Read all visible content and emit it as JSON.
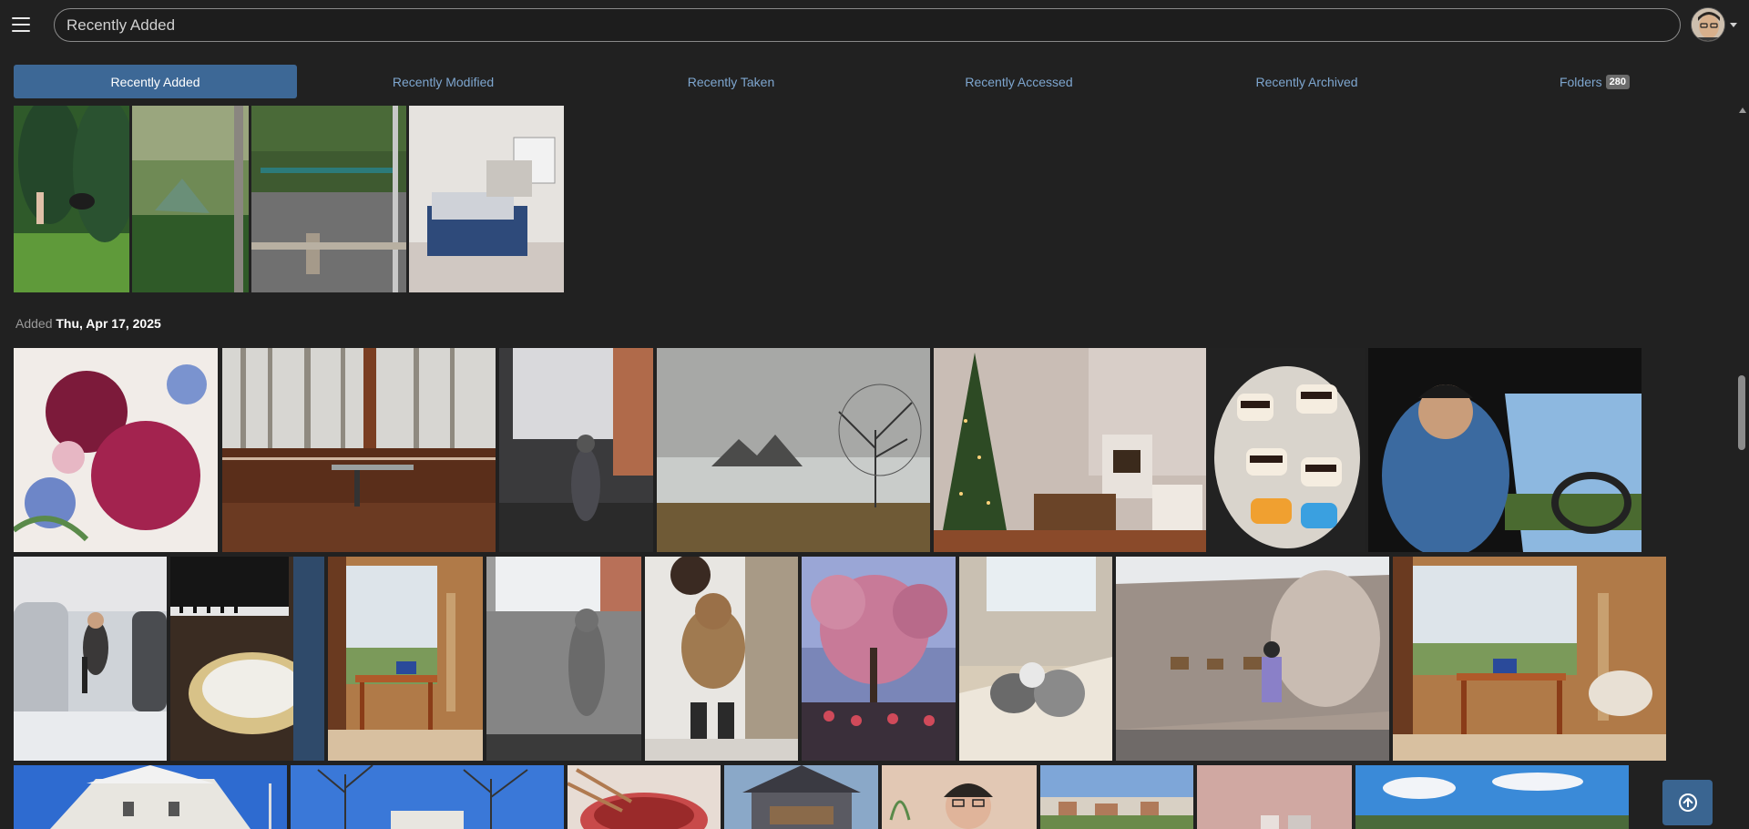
{
  "search": {
    "value": "Recently Added"
  },
  "icons": {
    "menu": "hamburger-icon",
    "avatar": "user-avatar",
    "caret": "chevron-down-icon",
    "back_to_top": "arrow-up-circle-icon"
  },
  "tabs": [
    {
      "label": "Recently Added",
      "active": true
    },
    {
      "label": "Recently Modified"
    },
    {
      "label": "Recently Taken"
    },
    {
      "label": "Recently Accessed"
    },
    {
      "label": "Recently Archived"
    },
    {
      "label": "Folders",
      "badge": "280"
    }
  ],
  "section": {
    "prefix": "Added",
    "date": "Thu, Apr 17, 2025"
  },
  "colors": {
    "accent": "#3d6896",
    "tab_text": "#7ea6cf",
    "background": "#212121"
  }
}
